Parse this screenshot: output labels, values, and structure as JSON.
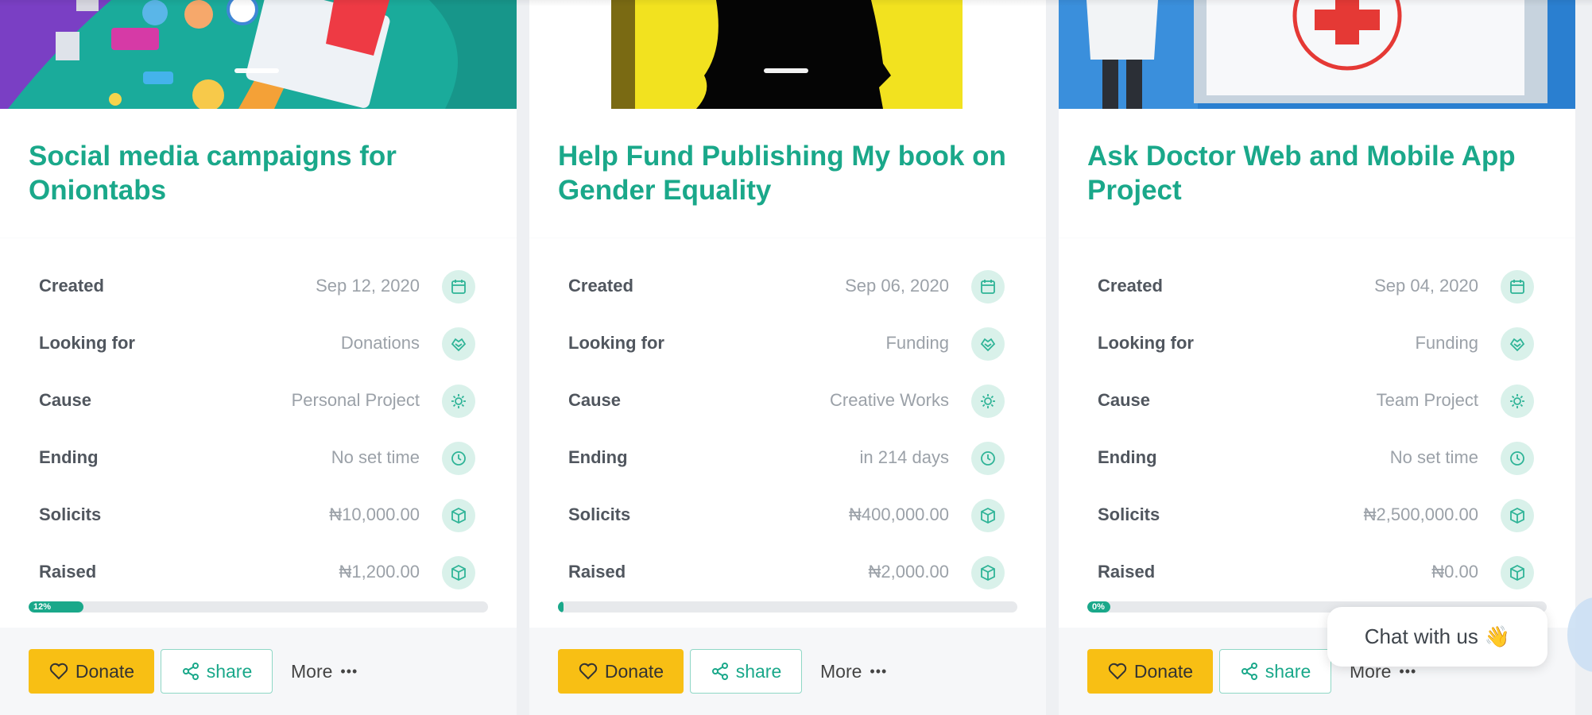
{
  "cards": [
    {
      "title": "Social media campaigns for Oniontabs",
      "rows": [
        {
          "label": "Created",
          "value": "Sep 12, 2020",
          "icon": "calendar-icon"
        },
        {
          "label": "Looking for",
          "value": "Donations",
          "icon": "hand-heart-icon"
        },
        {
          "label": "Cause",
          "value": "Personal Project",
          "icon": "gear-icon"
        },
        {
          "label": "Ending",
          "value": "No set time",
          "icon": "clock-icon"
        },
        {
          "label": "Solicits",
          "value": "₦10,000.00",
          "icon": "box-icon"
        },
        {
          "label": "Raised",
          "value": "₦1,200.00",
          "icon": "box-icon"
        }
      ],
      "progress_label": "12%",
      "progress_fraction": 0.12,
      "donate_label": "Donate",
      "share_label": "share",
      "more_label": "More"
    },
    {
      "title": "Help Fund Publishing My book on Gender Equality",
      "rows": [
        {
          "label": "Created",
          "value": "Sep 06, 2020",
          "icon": "calendar-icon"
        },
        {
          "label": "Looking for",
          "value": "Funding",
          "icon": "hand-heart-icon"
        },
        {
          "label": "Cause",
          "value": "Creative Works",
          "icon": "gear-icon"
        },
        {
          "label": "Ending",
          "value": "in 214 days",
          "icon": "clock-icon"
        },
        {
          "label": "Solicits",
          "value": "₦400,000.00",
          "icon": "box-icon"
        },
        {
          "label": "Raised",
          "value": "₦2,000.00",
          "icon": "box-icon"
        }
      ],
      "progress_label": "",
      "progress_fraction": 0.005,
      "donate_label": "Donate",
      "share_label": "share",
      "more_label": "More"
    },
    {
      "title": "Ask Doctor Web and Mobile App Project",
      "rows": [
        {
          "label": "Created",
          "value": "Sep 04, 2020",
          "icon": "calendar-icon"
        },
        {
          "label": "Looking for",
          "value": "Funding",
          "icon": "hand-heart-icon"
        },
        {
          "label": "Cause",
          "value": "Team Project",
          "icon": "gear-icon"
        },
        {
          "label": "Ending",
          "value": "No set time",
          "icon": "clock-icon"
        },
        {
          "label": "Solicits",
          "value": "₦2,500,000.00",
          "icon": "box-icon"
        },
        {
          "label": "Raised",
          "value": "₦0.00",
          "icon": "box-icon"
        }
      ],
      "progress_label": "0%",
      "progress_fraction": 0.0,
      "donate_label": "Donate",
      "share_label": "share",
      "more_label": "More"
    }
  ],
  "chat": {
    "label": "Chat with us",
    "emoji": "👋"
  },
  "colors": {
    "accent": "#1aa88a",
    "donate": "#f8bf14",
    "icon_bg": "#d9f1ea",
    "muted": "#9ba1a8"
  }
}
